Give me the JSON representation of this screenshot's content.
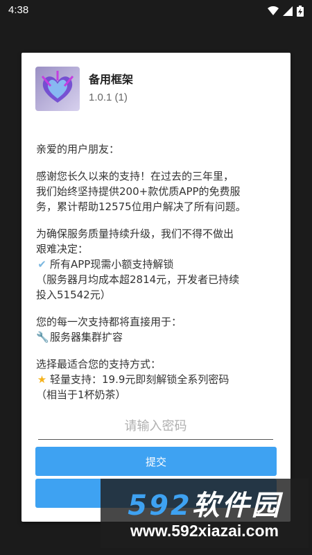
{
  "status_bar": {
    "time": "4:38",
    "icons": [
      "wifi-icon",
      "signal-icon",
      "battery-charging-icon"
    ]
  },
  "dialog": {
    "app_name": "备用框架",
    "app_version": "1.0.1 (1)",
    "greeting": "亲爱的用户朋友：",
    "para1": [
      "感谢您长久以来的支持！在过去的三年里，",
      "我们始终坚持提供200+款优质APP的免费服",
      "务，累计帮助12575位用户解决了所有问题。"
    ],
    "para2": [
      "为确保服务质量持续升级，我们不得不做出",
      "艰难决定："
    ],
    "para2_item": "所有APP现需小额支持解锁",
    "para2_note": [
      "（服务器月均成本超2814元，开发者已持续",
      "投入51542元）"
    ],
    "para3": "您的每一次支持都将直接用于：",
    "para3_item": "服务器集群扩容",
    "para4": "选择最适合您的支持方式：",
    "para4_item": "轻量支持：19.9元即刻解锁全系列密码",
    "para4_note": "（相当于1杯奶茶）",
    "password_placeholder": "请输入密码",
    "submit_label": "提交",
    "second_label": ""
  },
  "watermark": {
    "brand_num": "592",
    "brand_text": "软件园",
    "url": "www.592xiazai.com"
  },
  "colors": {
    "accent": "#3ea2f2",
    "scrim": "#1b1b1b"
  }
}
